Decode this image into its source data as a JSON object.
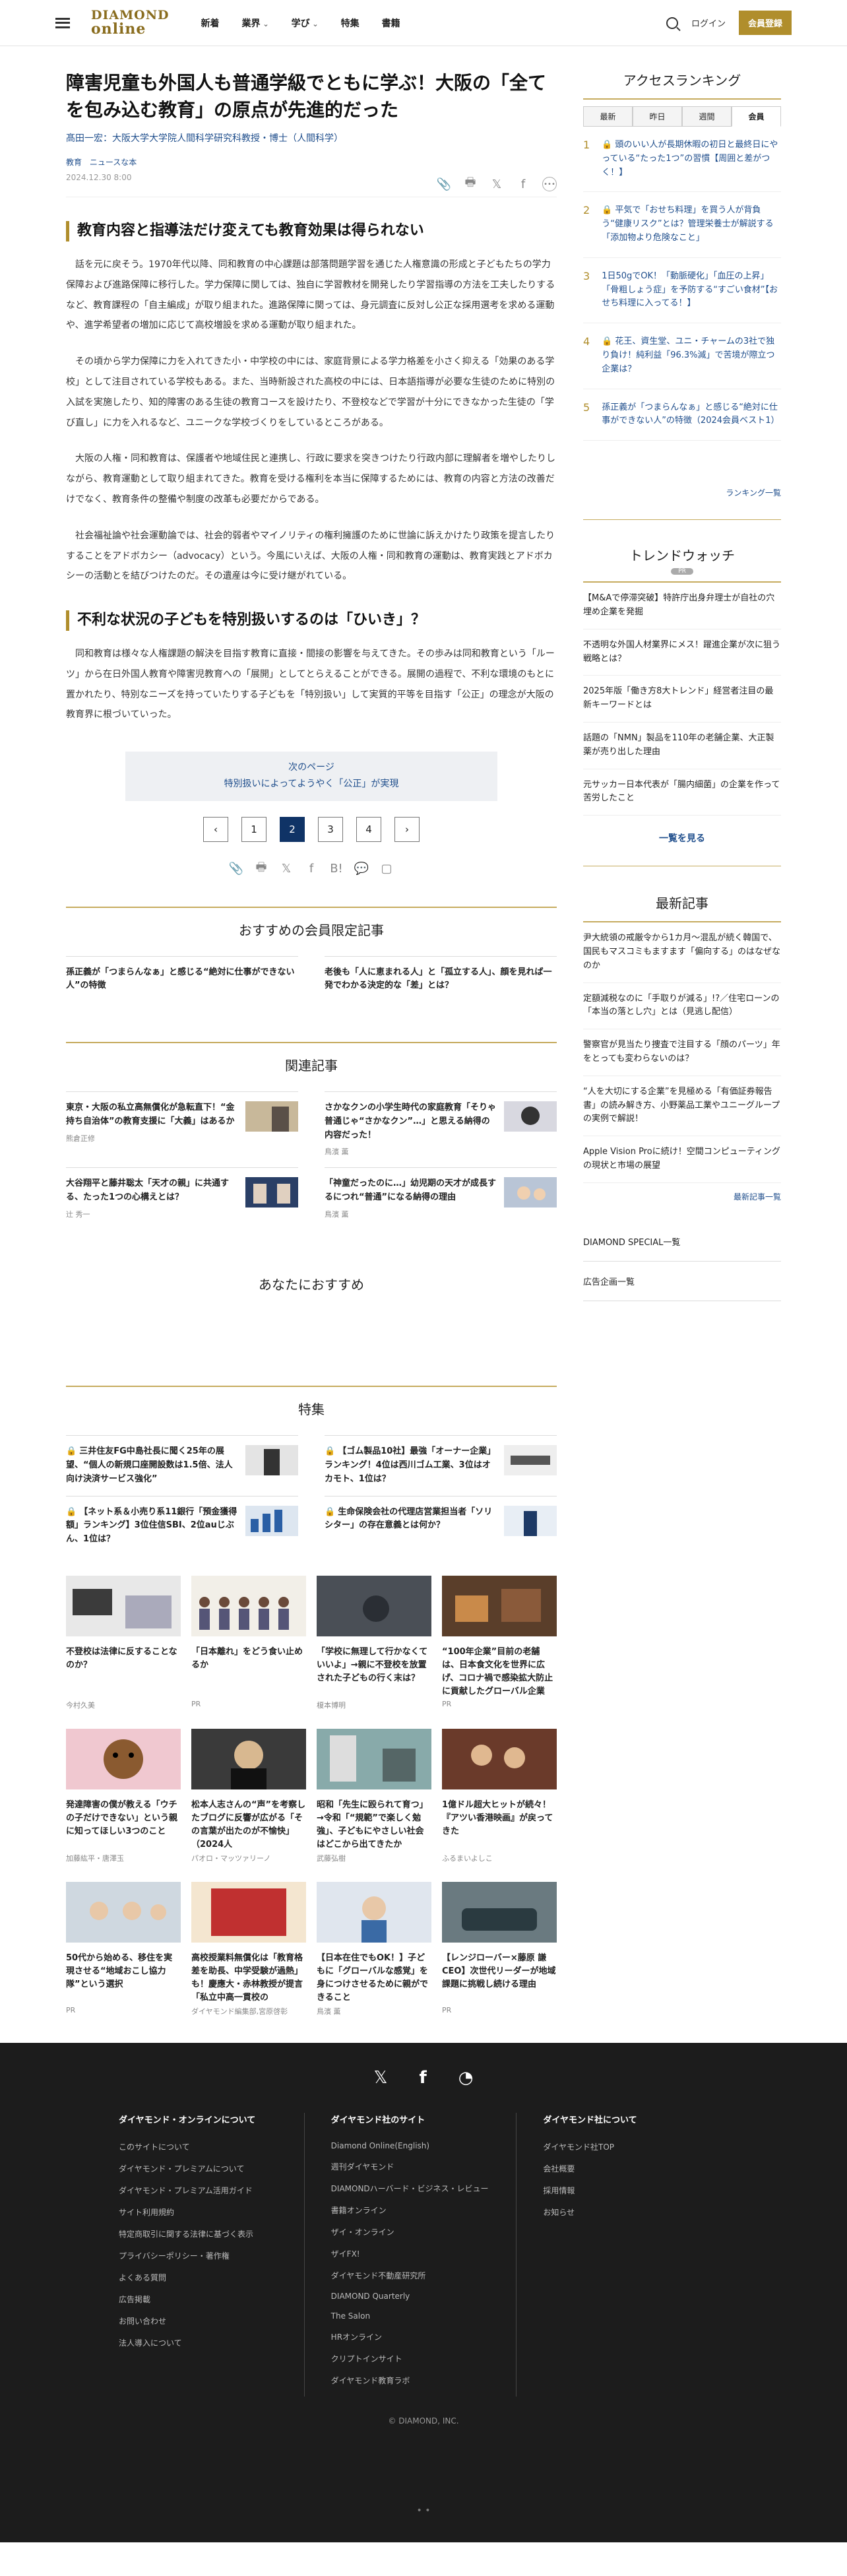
{
  "header": {
    "logo_line1": "DIAMOND",
    "logo_line2": "online",
    "nav": [
      "新着",
      "業界",
      "学び",
      "特集",
      "書籍"
    ],
    "login": "ログイン",
    "join": "会員登録"
  },
  "article": {
    "title": "障害児童も外国人も普通学級でともに学ぶ！大阪の「全てを包み込む教育」の原点が先進的だった",
    "author": "髙田一宏：大阪大学大学院人間科学研究科教授・博士（人間科学）",
    "tags": [
      "教育",
      "ニュースな本"
    ],
    "date": "2024.12.30 8:00",
    "h2_1": "教育内容と指導法だけ変えても教育効果は得られない",
    "p1": "話を元に戻そう。1970年代以降、同和教育の中心課題は部落問題学習を通じた人権意識の形成と子どもたちの学力保障および進路保障に移行した。学力保障に関しては、独自に学習教材を開発したり学習指導の方法を工夫したりするなど、教育課程の「自主編成」が取り組まれた。進路保障に関っては、身元調査に反対し公正な採用選考を求める運動や、進学希望者の増加に応じて高校増設を求める運動が取り組まれた。",
    "p2": "その頃から学力保障に力を入れてきた小・中学校の中には、家庭背景による学力格差を小さく抑える「効果のある学校」として注目されている学校もある。また、当時新設された高校の中には、日本語指導が必要な生徒のために特別の入試を実施したり、知的障害のある生徒の教育コースを設けたり、不登校などで学習が十分にできなかった生徒の「学び直し」に力を入れるなど、ユニークな学校づくりをしているところがある。",
    "p3": "大阪の人権・同和教育は、保護者や地域住民と連携し、行政に要求を突きつけたり行政内部に理解者を増やしたりしながら、教育運動として取り組まれてきた。教育を受ける権利を本当に保障するためには、教育の内容と方法の改善だけでなく、教育条件の整備や制度の改革も必要だからである。",
    "p4": "社会福祉論や社会運動論では、社会的弱者やマイノリティの権利擁護のために世論に訴えかけたり政策を提言したりすることをアドボカシー（advocacy）という。今風にいえば、大阪の人権・同和教育の運動は、教育実践とアドボカシーの活動とを結びつけたのだ。その遺産は今に受け継がれている。",
    "h2_2": "不利な状況の子どもを特別扱いするのは「ひいき」？",
    "p5": "同和教育は様々な人権課題の解決を目指す教育に直接・間接の影響を与えてきた。その歩みは同和教育という「ルーツ」から在日外国人教育や障害児教育への「展開」としてとらえることができる。展開の過程で、不利な環境のもとに置かれたり、特別なニーズを持っていたりする子どもを「特別扱い」して実質的平等を目指す「公正」の理念が大阪の教育界に根づいていった。",
    "next_label": "次のページ",
    "next_title": "特別扱いによってようやく「公正」が実現",
    "pages": [
      "1",
      "2",
      "3",
      "4"
    ]
  },
  "sections": {
    "recommend_members": "おすすめの会員限定記事",
    "related": "関連記事",
    "for_you": "あなたにおすすめ",
    "special": "特集"
  },
  "member_articles": [
    "孫正義が「つまらんなぁ」と感じる“絶対に仕事ができない人”の特徴",
    "老後も「人に恵まれる人」と「孤立する人」、顔を見れば一発でわかる決定的な「差」とは？"
  ],
  "related": [
    {
      "title": "東京・大阪の私立高無償化が急転直下！“金持ち自治体”の教育支援に「大義」はあるか",
      "author": "熊倉正修"
    },
    {
      "title": "さかなクンの小学生時代の家庭教育「そりゃ普通じゃ“さかなクン”…」と思える納得の内容だった！",
      "author": "鳥濱 薫"
    },
    {
      "title": "大谷翔平と藤井聡太「天才の親」に共通する、たった1つの心構えとは？",
      "author": "辻 秀一"
    },
    {
      "title": "「神童だったのに…」幼児期の天才が成長するにつれ“普通”になる納得の理由",
      "author": "鳥濱 薫"
    }
  ],
  "special": [
    {
      "title": "三井住友FG中島社長に聞く25年の展望、“個人の新規口座開設数は1.5倍、法人向け決済サービス強化”"
    },
    {
      "title": "【ゴム製品10社】最強「オーナー企業」ランキング！4位は西川ゴム工業、3位はオカモト、1位は？"
    },
    {
      "title": "【ネット系＆小売り系11銀行「預金獲得額」ランキング】3位住信SBI、2位auじぶん、1位は？"
    },
    {
      "title": "生命保険会社の代理店営業担当者「ソリシター」の存在意義とは何か？"
    }
  ],
  "cards": [
    {
      "title": "不登校は法律に反することなのか？",
      "author": "今村久美"
    },
    {
      "title": "「日本離れ」をどう食い止めるか",
      "author": "PR"
    },
    {
      "title": "「学校に無理して行かなくていいよ」→親に不登校を放置された子どもの行く末は？",
      "author": "榎本博明"
    },
    {
      "title": "“100年企業”目前の老舗は、日本食文化を世界に広げ、コロナ禍で感染拡大防止に貢献したグローバル企業",
      "author": "PR"
    },
    {
      "title": "発達障害の僕が教える「ウチの子だけできない」という親に知ってほしい3つのこと",
      "author": "加藤紘平・唐澤玉"
    },
    {
      "title": "松本人志さんの“声”を考察したブログに反響が広がる「その言葉が出たのが不愉快」（2024人",
      "author": "パオロ・マッツァリーノ"
    },
    {
      "title": "昭和「先生に殴られて育つ」→令和「“規範”で楽しく勉強」、子どもにやさしい社会はどこから出てきたか",
      "author": "武藤弘樹"
    },
    {
      "title": "1億ドル超大ヒットが続々！『アツい香港映画』が戻ってきた",
      "author": "ふるまいよしこ"
    },
    {
      "title": "50代から始める、移住を実現させる“地域おこし協力隊”という選択",
      "author": "PR"
    },
    {
      "title": "高校授業料無償化は「教育格差を助長、中学受験が過熱」も！慶應大・赤林教授が提言「私立中高一貫校の",
      "author": "ダイヤモンド編集部,宮原啓彰"
    },
    {
      "title": "【日本在住でもOK！】子どもに「グローバルな感覚」を身につけさせるために親ができること",
      "author": "鳥濱 薫"
    },
    {
      "title": "【レンジローバー×藤原 謙CEO】次世代リーダーが地域課題に挑戦し続ける理由",
      "author": "PR"
    }
  ],
  "ranking": {
    "title": "アクセスランキング",
    "tabs": [
      "最新",
      "昨日",
      "週間",
      "会員"
    ],
    "items": [
      {
        "num": "1",
        "title": "頭のいい人が長期休暇の初日と最終日にやっている“たった1つ”の習慣【周囲と差がつく！】"
      },
      {
        "num": "2",
        "title": "平気で「おせち料理」を買う人が背負う“健康リスク”とは？管理栄養士が解説する「添加物より危険なこと」"
      },
      {
        "num": "3",
        "title": "1日50gでOK！「動脈硬化」「血圧の上昇」「骨粗しょう症」を予防する“すごい食材”【おせち料理に入ってる！】"
      },
      {
        "num": "4",
        "title": "花王、資生堂、ユニ・チャームの3社で独り負け！純利益「96.3%減」で苦境が際立つ企業は？"
      },
      {
        "num": "5",
        "title": "孫正義が「つまらんなぁ」と感じる“絶対に仕事ができない人”の特徴（2024会員ベスト1）"
      }
    ],
    "more": "ランキング一覧"
  },
  "trend": {
    "title": "トレンドウォッチ",
    "badge": "PR",
    "items": [
      "【M&Aで停滞突破】特許庁出身弁理士が自社の穴埋め企業を発掘",
      "不透明な外国人材業界にメス！躍進企業が次に狙う戦略とは？",
      "2025年版「働き方8大トレンド」経営者注目の最新キーワードとは",
      "話題の「NMN」製品を110年の老舗企業、大正製薬が売り出した理由",
      "元サッカー日本代表が「腸内細菌」の企業を作って苦労したこと"
    ],
    "more": "一覧を見る"
  },
  "latest": {
    "title": "最新記事",
    "items": [
      "尹大統領の戒厳令から1カ月〜混乱が続く韓国で、国民もマスコミもますます「偏向する」のはなぜなのか",
      "定額減税なのに「手取りが減る」!?／住宅ローンの「本当の落とし穴」とは（見逃し配信）",
      "警察官が見当たり捜査で注目する「顔のパーツ」年をとっても変わらないのは？",
      "“人を大切にする企業”を見極める「有価証券報告書」の読み解き方、小野薬品工業やユニーグループの実例で解説！",
      "Apple Vision Proに続け！空間コンピューティングの現状と市場の展望"
    ],
    "more": "最新記事一覧"
  },
  "side_links": [
    "DIAMOND SPECIAL一覧",
    "広告企画一覧"
  ],
  "footer": {
    "col1_title": "ダイヤモンド・オンラインについて",
    "col1": [
      "このサイトについて",
      "ダイヤモンド・プレミアムについて",
      "ダイヤモンド・プレミアム活用ガイド",
      "サイト利用規約",
      "特定商取引に関する法律に基づく表示",
      "プライバシーポリシー・著作権",
      "よくある質問",
      "広告掲載",
      "お問い合わせ",
      "法人導入について"
    ],
    "col2_title": "ダイヤモンド社のサイト",
    "col2": [
      "Diamond Online(English)",
      "週刊ダイヤモンド",
      "DIAMONDハーバード・ビジネス・レビュー",
      "書籍オンライン",
      "ザイ・オンライン",
      "ザイFX!",
      "ダイヤモンド不動産研究所",
      "DIAMOND Quarterly",
      "The Salon",
      "HRオンライン",
      "クリプトインサイト",
      "ダイヤモンド教育ラボ"
    ],
    "col3_title": "ダイヤモンド社について",
    "col3": [
      "ダイヤモンド社TOP",
      "会社概要",
      "採用情報",
      "お知らせ"
    ],
    "copyright": "© DIAMOND, INC."
  },
  "colors": {
    "gold": "#b08e2c",
    "navy": "#0f3366",
    "link": "#1f4e8c"
  }
}
